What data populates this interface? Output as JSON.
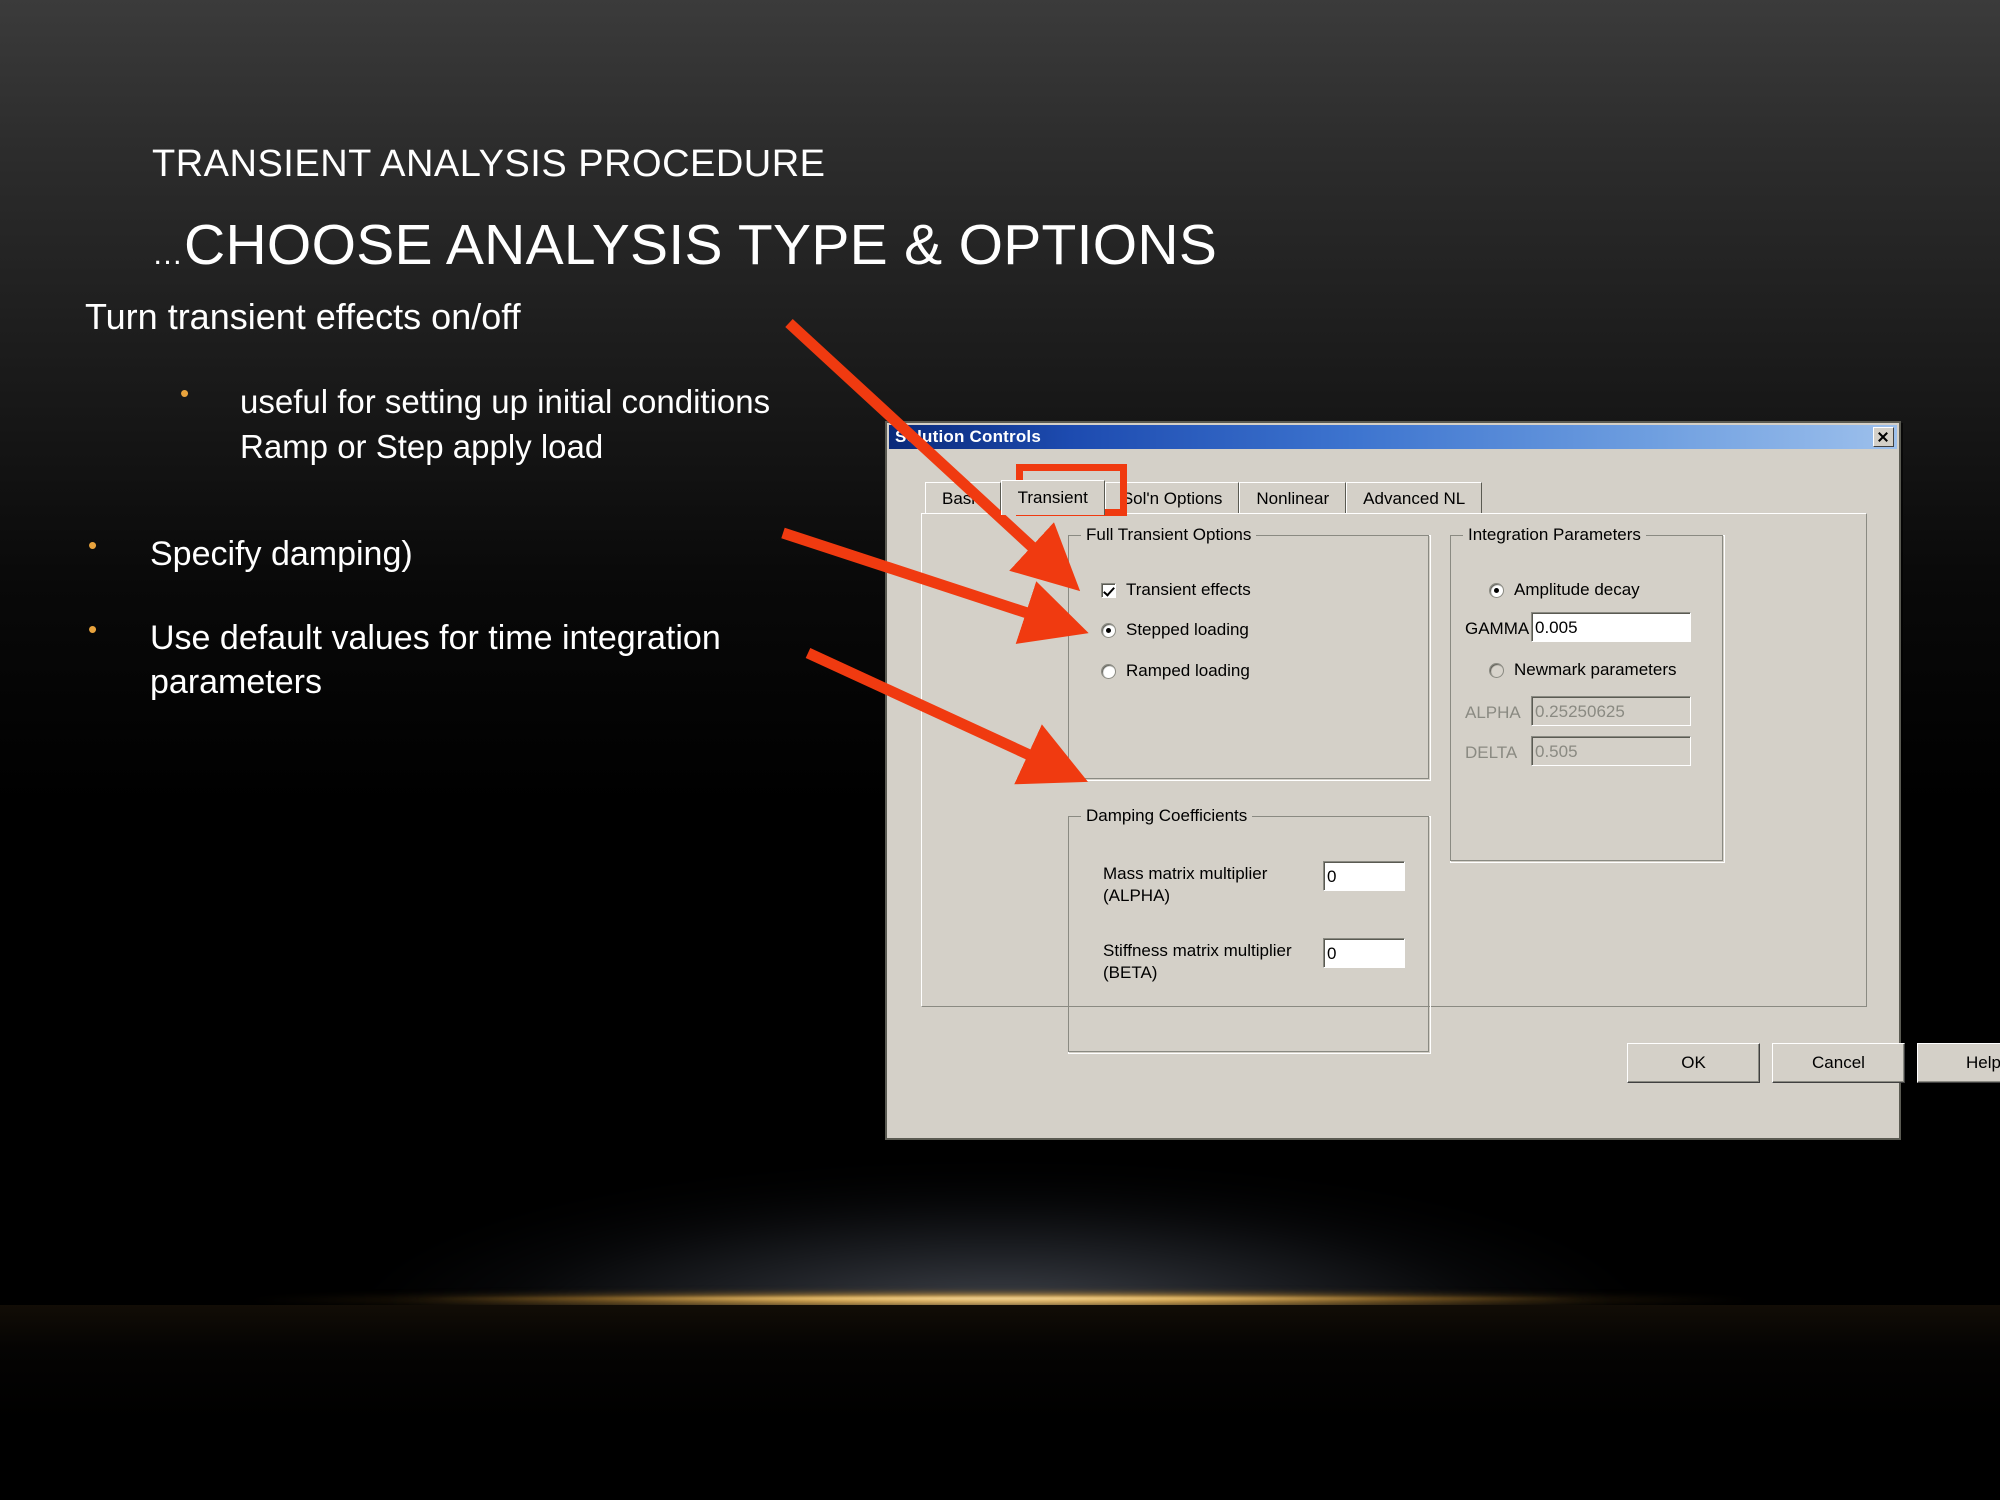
{
  "slide": {
    "kicker": "TRANSIENT ANALYSIS PROCEDURE",
    "headline_ellipsis": "…",
    "headline": "CHOOSE ANALYSIS TYPE & OPTIONS",
    "lead": "Turn transient effects on/off",
    "bullet_glyph": "•",
    "bullet_color": "#e8a33d",
    "bullets": [
      {
        "level": 2,
        "text": "useful for setting up initial conditions\nRamp or Step apply load"
      },
      {
        "level": 1,
        "text": "Specify damping)"
      },
      {
        "level": 1,
        "text": "Use default values for time integration\nparameters"
      }
    ],
    "accent_color": "#f03a10"
  },
  "dialog": {
    "title": "Solution Controls",
    "close_label": "×",
    "tabs": [
      {
        "label": "Basic",
        "selected": false
      },
      {
        "label": "Transient",
        "selected": true
      },
      {
        "label": "Sol'n Options",
        "selected": false
      },
      {
        "label": "Nonlinear",
        "selected": false
      },
      {
        "label": "Advanced NL",
        "selected": false
      }
    ],
    "full_transient_options": {
      "title": "Full Transient Options",
      "transient_effects": {
        "label": "Transient effects",
        "checked": true
      },
      "stepped_loading": {
        "label": "Stepped loading",
        "checked": true
      },
      "ramped_loading": {
        "label": "Ramped loading",
        "checked": false
      }
    },
    "damping_coefficients": {
      "title": "Damping Coefficients",
      "mass_label": "Mass matrix multiplier\n(ALPHA)",
      "mass_value": "0",
      "stiffness_label": "Stiffness matrix multiplier\n(BETA)",
      "stiffness_value": "0"
    },
    "integration_parameters": {
      "title": "Integration Parameters",
      "amplitude_decay": {
        "label": "Amplitude decay",
        "checked": true
      },
      "gamma_label": "GAMMA",
      "gamma_value": "0.005",
      "newmark": {
        "label": "Newmark parameters",
        "checked": false
      },
      "alpha_label": "ALPHA",
      "alpha_value": "0.25250625",
      "delta_label": "DELTA",
      "delta_value": "0.505"
    },
    "buttons": {
      "ok": "OK",
      "cancel": "Cancel",
      "help": "Help"
    }
  }
}
